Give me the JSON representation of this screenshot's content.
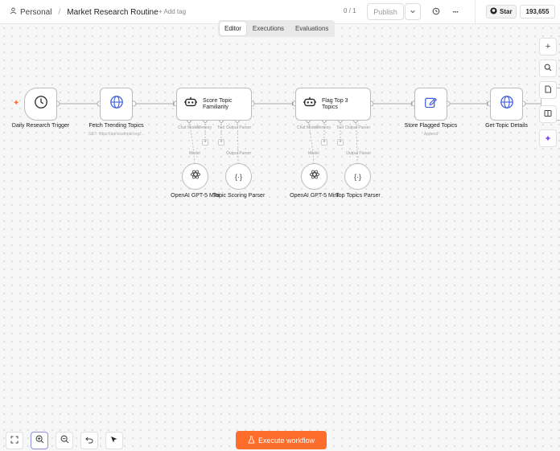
{
  "header": {
    "project": "Personal",
    "separator": "/",
    "workflow_title": "Market Research Routine",
    "add_tag": "+ Add tag",
    "version": "0 / 1",
    "publish": "Publish",
    "star": "Star",
    "star_count": "193,655"
  },
  "tabs": [
    {
      "label": "Editor",
      "active": true
    },
    {
      "label": "Executions",
      "active": false
    },
    {
      "label": "Evaluations",
      "active": false
    }
  ],
  "nodes": {
    "trigger": {
      "label": "Daily Research Trigger"
    },
    "fetch": {
      "label": "Fetch Trending Topics",
      "subtitle": "GET: https://api.example.org/..."
    },
    "score": {
      "label": "Score Topic Familiarity"
    },
    "flag": {
      "label": "Flag Top 3 Topics"
    },
    "store": {
      "label": "Store Flagged Topics",
      "subtitle": "Append"
    },
    "details": {
      "label": "Get Topic Details"
    }
  },
  "sub_nodes": {
    "model1": "OpenAI GPT-5 Mini",
    "parser1": "Topic Scoring Parser",
    "model2": "OpenAI GPT-5 Mini",
    "parser2": "Top Topics Parser"
  },
  "connector_labels": {
    "chat_model": "Chat Model",
    "memory": "Memory",
    "tool": "Tool",
    "output_parser": "Output Parser",
    "model": "Model"
  },
  "side_toolbar": [
    "plus-icon",
    "search-icon",
    "note-icon",
    "panel-icon",
    "sparkle-icon"
  ],
  "bottom_toolbar": [
    "fit-view-icon",
    "zoom-in-icon",
    "zoom-out-icon",
    "undo-icon",
    "pointer-icon"
  ],
  "execute_button": "Execute workflow",
  "colors": {
    "accent": "#ff6d2d",
    "selected_outline": "#8f8fe8",
    "trigger_bolt": "#ff6d2d"
  }
}
